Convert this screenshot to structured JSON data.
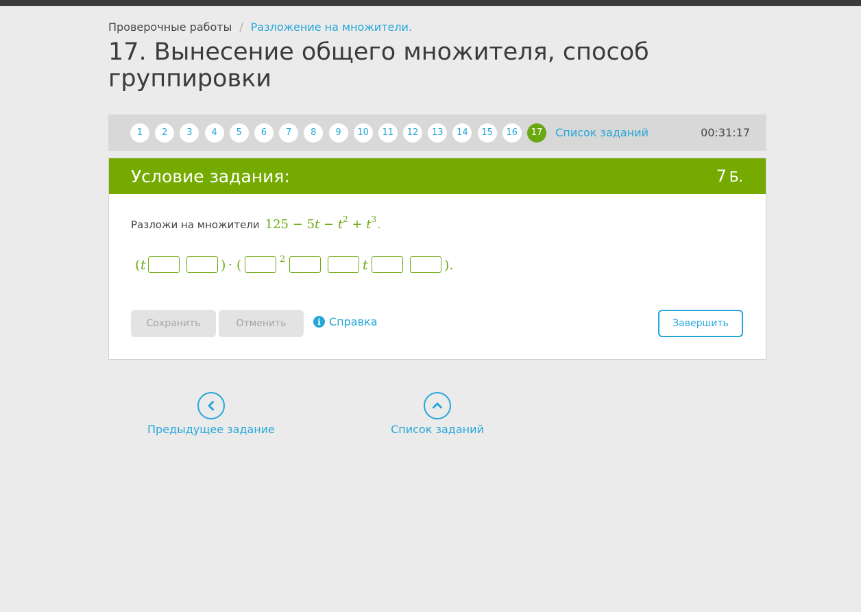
{
  "breadcrumb": {
    "item1": "Проверочные работы",
    "separator": "/",
    "item2": "Разложение на множители."
  },
  "page_title": "17. Вынесение общего множителя, способ группировки",
  "task_nav": {
    "numbers": [
      "1",
      "2",
      "3",
      "4",
      "5",
      "6",
      "7",
      "8",
      "9",
      "10",
      "11",
      "12",
      "13",
      "14",
      "15",
      "16",
      "17"
    ],
    "active": "17",
    "list_link": "Список заданий",
    "timer": "00:31:17"
  },
  "card": {
    "title": "Условие задания:",
    "points": "7",
    "points_unit": "Б."
  },
  "question": {
    "text": "Разложи на множители",
    "math": {
      "a": "125",
      "minus1": "−",
      "b": "5",
      "var1": "t",
      "minus2": "−",
      "var2": "t",
      "exp2": "2",
      "plus": "+",
      "var3": "t",
      "exp3": "3"
    },
    "end": "."
  },
  "answer": {
    "open1": "(",
    "var1": "t",
    "close1": ")",
    "dot": "·",
    "open2": "(",
    "exp": "2",
    "var2": "t",
    "close2": ").",
    "inputs": [
      "",
      "",
      "",
      "",
      "",
      "",
      ""
    ]
  },
  "buttons": {
    "save": "Сохранить",
    "cancel": "Отменить",
    "help": "Справка",
    "help_icon_glyph": "i",
    "finish": "Завершить"
  },
  "bottom_nav": {
    "prev": "Предыдущее задание",
    "list": "Список заданий"
  },
  "colors": {
    "accent_blue": "#25a6d8",
    "accent_green": "#75ab00",
    "background": "#ebebeb"
  },
  "icons": {
    "help": "info-circle-icon",
    "prev": "chevron-left-circle-icon",
    "list": "chevron-up-circle-icon"
  }
}
